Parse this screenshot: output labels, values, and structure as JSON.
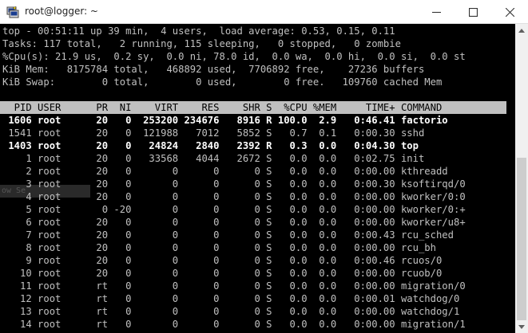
{
  "window": {
    "title": "root@logger: ~"
  },
  "ghost_text": "ow Se",
  "top": {
    "summary": [
      "top - 00:51:11 up 39 min,  4 users,  load average: 0.53, 0.15, 0.11",
      "Tasks: 117 total,   2 running, 115 sleeping,   0 stopped,   0 zombie",
      "%Cpu(s): 21.9 us,  0.2 sy,  0.0 ni, 78.0 id,  0.0 wa,  0.0 hi,  0.0 si,  0.0 st",
      "KiB Mem:   8175784 total,   468892 used,  7706892 free,    27236 buffers",
      "KiB Swap:        0 total,        0 used,        0 free.   109760 cached Mem"
    ],
    "header": "  PID USER      PR  NI    VIRT    RES    SHR S  %CPU %MEM     TIME+ COMMAND",
    "processes": [
      {
        "text": " 1606 root      20   0  253200 234676   8916 R 100.0  2.9   0:46.41 factorio",
        "bold": true
      },
      {
        "text": " 1541 root      20   0  121988   7012   5852 S   0.7  0.1   0:00.30 sshd",
        "bold": false
      },
      {
        "text": " 1403 root      20   0   24824   2840   2392 R   0.3  0.0   0:04.30 top",
        "bold": true
      },
      {
        "text": "    1 root      20   0   33568   4044   2672 S   0.0  0.0   0:02.75 init",
        "bold": false
      },
      {
        "text": "    2 root      20   0       0      0      0 S   0.0  0.0   0:00.00 kthreadd",
        "bold": false
      },
      {
        "text": "    3 root      20   0       0      0      0 S   0.0  0.0   0:00.30 ksoftirqd/0",
        "bold": false
      },
      {
        "text": "    4 root      20   0       0      0      0 S   0.0  0.0   0:00.00 kworker/0:0",
        "bold": false
      },
      {
        "text": "    5 root       0 -20       0      0      0 S   0.0  0.0   0:00.00 kworker/0:+",
        "bold": false
      },
      {
        "text": "    6 root      20   0       0      0      0 S   0.0  0.0   0:00.00 kworker/u8+",
        "bold": false
      },
      {
        "text": "    7 root      20   0       0      0      0 S   0.0  0.0   0:00.43 rcu_sched",
        "bold": false
      },
      {
        "text": "    8 root      20   0       0      0      0 S   0.0  0.0   0:00.00 rcu_bh",
        "bold": false
      },
      {
        "text": "    9 root      20   0       0      0      0 S   0.0  0.0   0:00.46 rcuos/0",
        "bold": false
      },
      {
        "text": "   10 root      20   0       0      0      0 S   0.0  0.0   0:00.00 rcuob/0",
        "bold": false
      },
      {
        "text": "   11 root      rt   0       0      0      0 S   0.0  0.0   0:00.00 migration/0",
        "bold": false
      },
      {
        "text": "   12 root      rt   0       0      0      0 S   0.0  0.0   0:00.01 watchdog/0",
        "bold": false
      },
      {
        "text": "   13 root      rt   0       0      0      0 S   0.0  0.0   0:00.00 watchdog/1",
        "bold": false
      },
      {
        "text": "   14 root      rt   0       0      0      0 S   0.0  0.0   0:00.00 migration/1",
        "bold": false
      }
    ]
  }
}
